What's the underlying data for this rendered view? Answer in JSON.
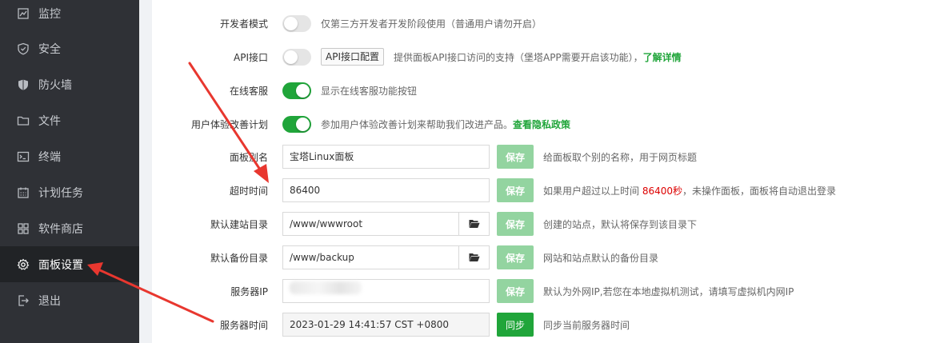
{
  "sidebar": {
    "items": [
      {
        "label": "监控",
        "icon": "monitor-icon"
      },
      {
        "label": "安全",
        "icon": "shield-icon"
      },
      {
        "label": "防火墙",
        "icon": "firewall-shield-icon"
      },
      {
        "label": "文件",
        "icon": "folder-icon"
      },
      {
        "label": "终端",
        "icon": "terminal-icon"
      },
      {
        "label": "计划任务",
        "icon": "calendar-icon"
      },
      {
        "label": "软件商店",
        "icon": "grid-icon"
      },
      {
        "label": "面板设置",
        "icon": "gear-icon",
        "active": true
      },
      {
        "label": "退出",
        "icon": "logout-icon"
      }
    ]
  },
  "settings": {
    "dev_mode": {
      "label": "开发者模式",
      "on": false,
      "tip": "仅第三方开发者开发阶段使用（普通用户请勿开启）"
    },
    "api": {
      "label": "API接口",
      "on": false,
      "button": "API接口配置",
      "tip": "提供面板API接口访问的支持（堡塔APP需要开启该功能），",
      "link": "了解详情"
    },
    "online_service": {
      "label": "在线客服",
      "on": true,
      "tip": "显示在线客服功能按钮"
    },
    "ux_plan": {
      "label": "用户体验改善计划",
      "on": true,
      "tip": "参加用户体验改善计划来帮助我们改进产品。",
      "link": "查看隐私政策"
    },
    "panel_alias": {
      "label": "面板别名",
      "value": "宝塔Linux面板",
      "save": "保存",
      "tip": "给面板取个别的名称，用于网页标题"
    },
    "timeout": {
      "label": "超时时间",
      "value": "86400",
      "save": "保存",
      "tip_pre": "如果用户超过以上时间 ",
      "tip_red": "86400秒",
      "tip_post": "，未操作面板，面板将自动退出登录"
    },
    "site_dir": {
      "label": "默认建站目录",
      "value": "/www/wwwroot",
      "save": "保存",
      "tip": "创建的站点，默认将保存到该目录下"
    },
    "backup_dir": {
      "label": "默认备份目录",
      "value": "/www/backup",
      "save": "保存",
      "tip": "网站和站点默认的备份目录"
    },
    "server_ip": {
      "label": "服务器IP",
      "value": "",
      "save": "保存",
      "tip": "默认为外网IP,若您在本地虚拟机测试，请填写虚拟机内网IP"
    },
    "server_time": {
      "label": "服务器时间",
      "value": "2023-01-29 14:41:57 CST +0800",
      "sync": "同步",
      "tip": "同步当前服务器时间"
    }
  },
  "colors": {
    "accent": "#20a53a",
    "sidebar_bg": "#2f3136",
    "arrow": "#e8372f"
  }
}
